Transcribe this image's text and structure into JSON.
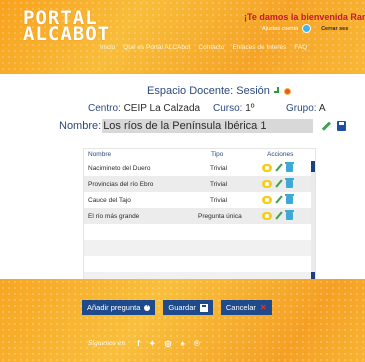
{
  "header": {
    "logo_line1": "PORTAL",
    "logo_line2": "ALCABOT",
    "welcome": "¡Te damos la bienvenida Ramón",
    "user_settings": "Ajustes cuenta",
    "logout": "Cerrar ses",
    "nav": [
      "Inicio",
      "Qué es Portal ALCAbot",
      "Contacto",
      "Enlaces de Interés",
      "FAQ"
    ]
  },
  "session": {
    "title": "Espacio Docente: Sesión",
    "centro_label": "Centro:",
    "centro_value": "CEIP La Calzada",
    "curso_label": "Curso:",
    "curso_value": "1º",
    "grupo_label": "Grupo:",
    "grupo_value": "A",
    "nombre_label": "Nombre:",
    "nombre_value": "Los ríos de la Península Ibérica 1"
  },
  "table": {
    "headers": [
      "Nombre",
      "Tipo",
      "Acciones"
    ],
    "rows": [
      {
        "name": "Nacimineto del Duero",
        "type": "Trivial"
      },
      {
        "name": "Provincias del río Ebro",
        "type": "Trivial"
      },
      {
        "name": "Cauce del Tajo",
        "type": "Trivial"
      },
      {
        "name": "El río más grande",
        "type": "Pregunta única"
      }
    ]
  },
  "buttons": {
    "add": "Añadir pregunta",
    "save": "Guardar",
    "cancel": "Cancelar"
  },
  "footer": {
    "social_label": "Síguenos en",
    "social_icons": [
      "facebook-icon",
      "twitter-icon",
      "instagram-icon",
      "snapchat-icon",
      "pinterest-icon"
    ]
  },
  "colors": {
    "orange": "#f9a21e",
    "navy": "#1f4a8c",
    "title_blue": "#2b4a7e",
    "welcome_red": "#c4182f"
  }
}
